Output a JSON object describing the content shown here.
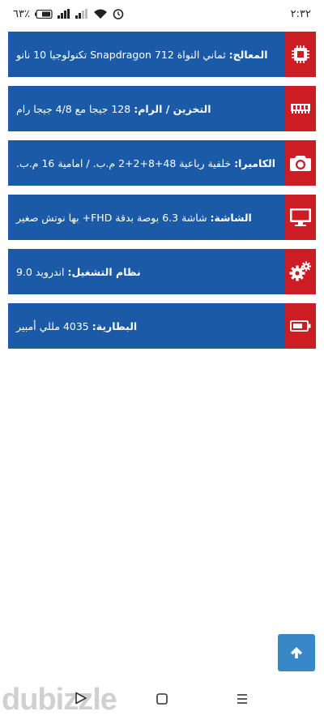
{
  "status_bar": {
    "time": "٢:٣٢",
    "battery": "٦٣٪"
  },
  "specs": [
    {
      "label": "المعالج:",
      "value": "ثماني النواة Snapdragon 712 تكنولوجيا 10 نانو",
      "icon": "cpu-icon"
    },
    {
      "label": "التخزين / الرام:",
      "value": "128 جيجا مع 4/8 جيجا رام",
      "icon": "ram-icon"
    },
    {
      "label": "الكاميرا:",
      "value": "خلفية رباعية 48+8+2+2 م.ب. / امامية 16 م.ب.",
      "icon": "camera-icon"
    },
    {
      "label": "الشاشة:",
      "value": "شاشة 6.3 بوصة بدقة FHD+ بها نوتش صغير",
      "icon": "monitor-icon"
    },
    {
      "label": "نظام التشغيل:",
      "value": "اندرويد 9.0",
      "icon": "gears-icon"
    },
    {
      "label": "البطارية:",
      "value": "4035 مللي أمبير",
      "icon": "battery-icon"
    }
  ],
  "watermark": {
    "text": "dubizzle"
  },
  "colors": {
    "row": "#1a5aa6",
    "icon_bg": "#cc1d24",
    "scroll_button": "#3a87c8"
  }
}
